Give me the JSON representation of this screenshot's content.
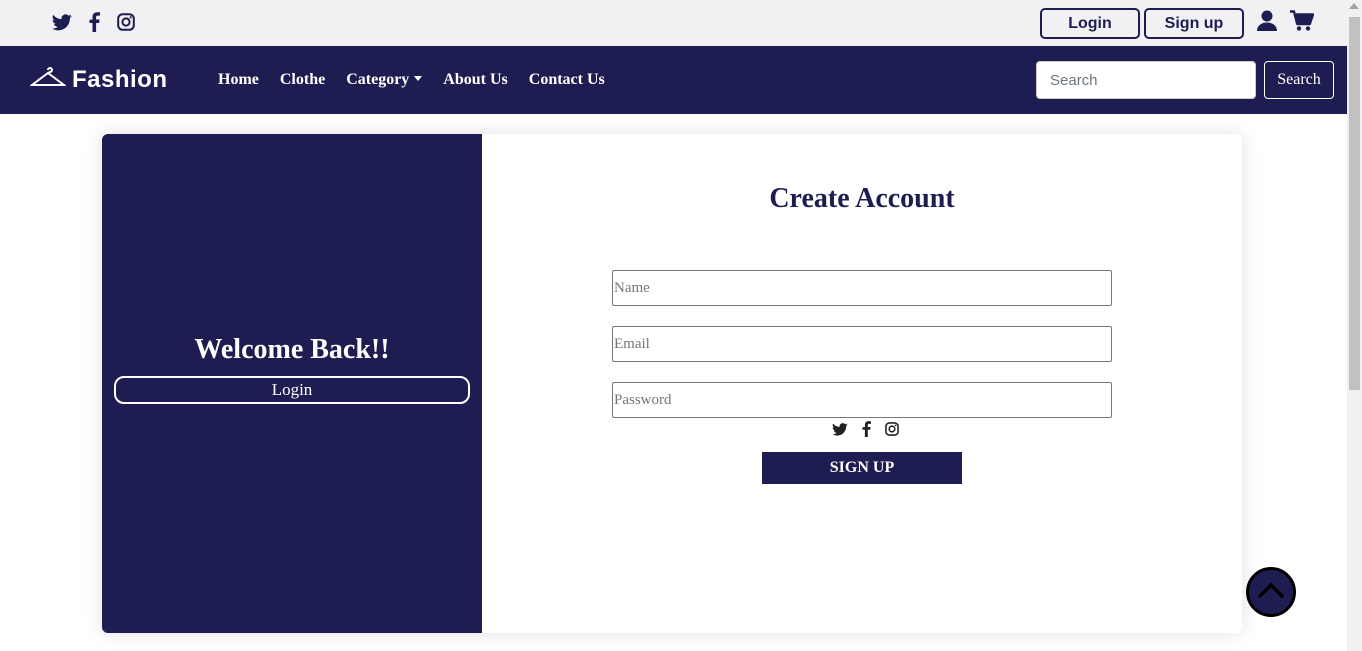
{
  "topbar": {
    "social_icons": [
      "twitter-icon",
      "facebook-icon",
      "instagram-icon"
    ],
    "login_label": "Login",
    "signup_label": "Sign up",
    "user_icon": "user-icon",
    "cart_icon": "cart-icon"
  },
  "navbar": {
    "brand": "Fashion",
    "brand_icon": "hanger-icon",
    "links": [
      "Home",
      "Clothe",
      "Category",
      "About Us",
      "Contact Us"
    ],
    "search_placeholder": "Search",
    "search_button": "Search"
  },
  "welcome_panel": {
    "heading": "Welcome Back!!",
    "login_button": "Login"
  },
  "form": {
    "title": "Create Account",
    "name_placeholder": "Name",
    "email_placeholder": "Email",
    "password_placeholder": "Password",
    "social_icons": [
      "twitter-icon",
      "facebook-icon",
      "instagram-icon"
    ],
    "submit_label": "SIGN UP"
  },
  "back_to_top_icon": "chevron-up-icon",
  "colors": {
    "primary": "#1e1d52",
    "topbar_bg": "#f1f1f3",
    "white": "#ffffff"
  }
}
